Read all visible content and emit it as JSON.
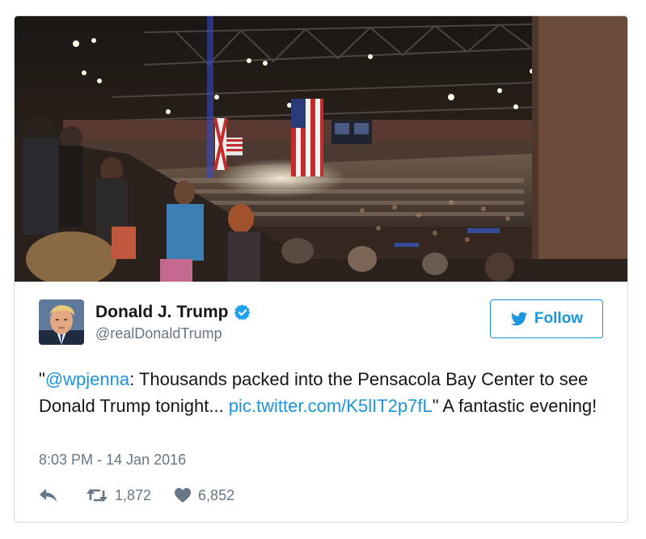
{
  "tweet": {
    "author_name": "Donald J. Trump",
    "handle": "@realDonaldTrump",
    "follow_label": "Follow",
    "text": {
      "open_quote": "\"",
      "mention": "@wpjenna",
      "body": ": Thousands packed into the Pensacola Bay Center to see Donald Trump tonight... ",
      "link": "pic.twitter.com/K5lIT2p7fL",
      "tail": "\" A fantastic evening!"
    },
    "timestamp": "8:03 PM - 14 Jan 2016",
    "retweets": "1,872",
    "likes": "6,852"
  },
  "icons": {
    "verified": "verified-badge-icon",
    "follow": "bird-icon",
    "reply": "reply-icon",
    "retweet": "retweet-icon",
    "like": "heart-icon"
  },
  "colors": {
    "accent": "#1b95e0",
    "muted": "#657786",
    "text": "#14171a",
    "border": "#d6dbdf"
  }
}
